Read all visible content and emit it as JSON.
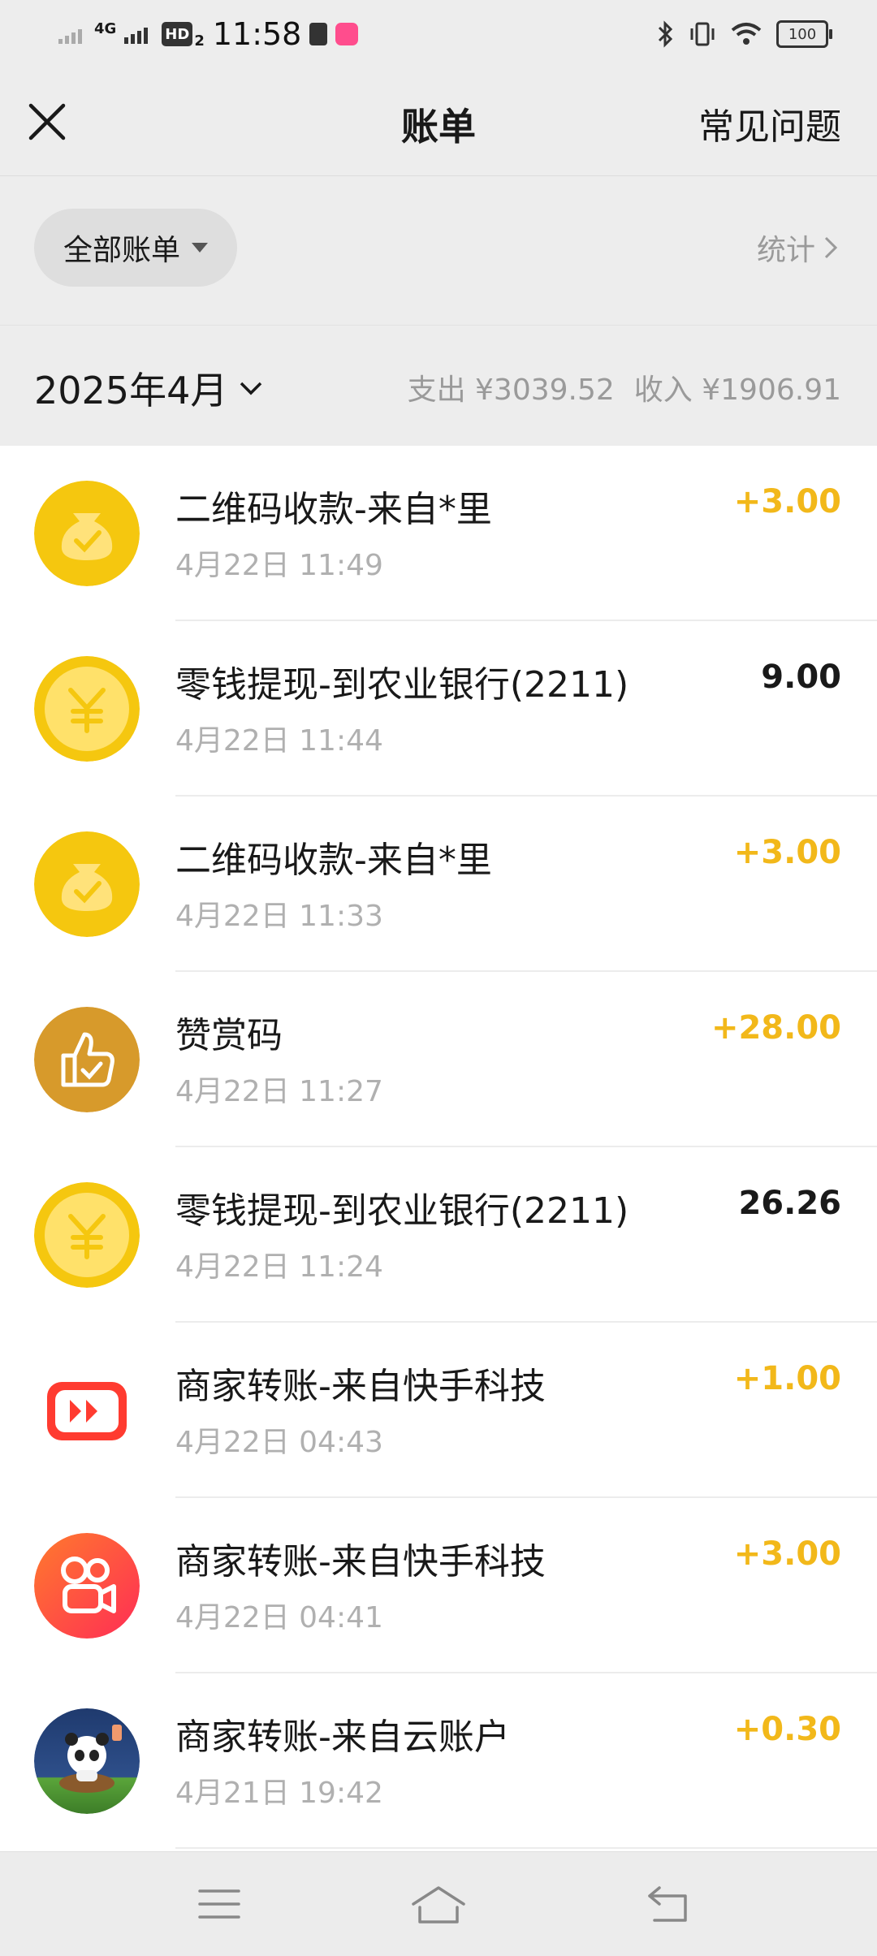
{
  "status_bar": {
    "signal_label": "4G",
    "hd_label": "HD",
    "hd_sub": "2",
    "time": "11:58",
    "battery": "100"
  },
  "nav": {
    "title": "账单",
    "faq_label": "常见问题"
  },
  "filter": {
    "label": "全部账单",
    "stats_label": "统计"
  },
  "month": {
    "label": "2025年4月",
    "expense": "支出 ¥3039.52",
    "income": "收入 ¥1906.91"
  },
  "transactions": [
    {
      "title": "二维码收款-来自*里",
      "time": "4月22日 11:49",
      "amount": "+3.00",
      "kind": "income",
      "icon": "qr-money-bag-icon"
    },
    {
      "title": "零钱提现-到农业银行(2211)",
      "time": "4月22日 11:44",
      "amount": "9.00",
      "kind": "expense",
      "icon": "yuan-coin-icon"
    },
    {
      "title": "二维码收款-来自*里",
      "time": "4月22日 11:33",
      "amount": "+3.00",
      "kind": "income",
      "icon": "qr-money-bag-icon"
    },
    {
      "title": "赞赏码",
      "time": "4月22日 11:27",
      "amount": "+28.00",
      "kind": "income",
      "icon": "thumbs-up-icon"
    },
    {
      "title": "零钱提现-到农业银行(2211)",
      "time": "4月22日 11:24",
      "amount": "26.26",
      "kind": "expense",
      "icon": "yuan-coin-icon"
    },
    {
      "title": "商家转账-来自快手科技",
      "time": "4月22日 04:43",
      "amount": "+1.00",
      "kind": "income",
      "icon": "kuaishou-play-icon"
    },
    {
      "title": "商家转账-来自快手科技",
      "time": "4月22日 04:41",
      "amount": "+3.00",
      "kind": "income",
      "icon": "kuaishou-logo-icon"
    },
    {
      "title": "商家转账-来自云账户",
      "time": "4月21日 19:42",
      "amount": "+0.30",
      "kind": "income",
      "icon": "panda-avatar-icon"
    }
  ],
  "colors": {
    "income": "#f2b81a",
    "expense": "#191919",
    "coin_yellow": "#f5c70f",
    "thumb_gold": "#d79a2b",
    "kuaishou_red": "#ff4b3b"
  }
}
